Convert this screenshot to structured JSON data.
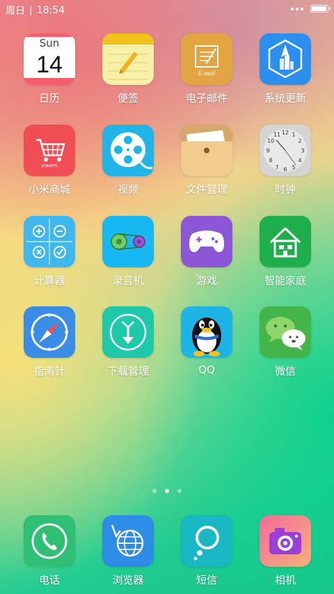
{
  "statusbar": {
    "day": "周日",
    "separator": "|",
    "time": "18:54"
  },
  "calendar": {
    "weekday": "Sun",
    "date": "14"
  },
  "apps": {
    "calendar": "日历",
    "notes": "便签",
    "email": "电子邮件",
    "email_icon_text": "E-mail",
    "system_update": "系统更新",
    "mi_store": "小米商城",
    "mi_store_icon_text": "xiaomi",
    "video": "视频",
    "file_manager": "文件管理",
    "clock": "时钟",
    "calculator": "计算器",
    "recorder": "录音机",
    "games": "游戏",
    "smart_home": "智能家庭",
    "compass": "指南针",
    "downloads": "下载管理",
    "qq": "QQ",
    "wechat": "微信"
  },
  "dock": {
    "phone": "电话",
    "browser": "浏览器",
    "messages": "短信",
    "camera": "相机"
  },
  "pager": {
    "count": 3,
    "active": 2
  },
  "colors": {
    "calendar_top": "#f45d6b",
    "notes": "#f6e56a",
    "email": "#e3a542",
    "update": "#2b8ff0",
    "store": "#f04e55",
    "video": "#1fb5e8",
    "files": "#f0c98a",
    "clock": "#d9d9d9",
    "calculator": "#1ea6e8",
    "recorder": "#17b7f2",
    "games": "#8c57d6",
    "smarthome": "#1fae4c",
    "compass": "#3a8de6",
    "downloads": "#1ec9a9",
    "qq": "#1db4e6",
    "wechat": "#43b549",
    "phone": "#2fbf75",
    "browser": "#2c8ce6",
    "messages": "#18b7c4",
    "camera": "#f36a9a"
  }
}
